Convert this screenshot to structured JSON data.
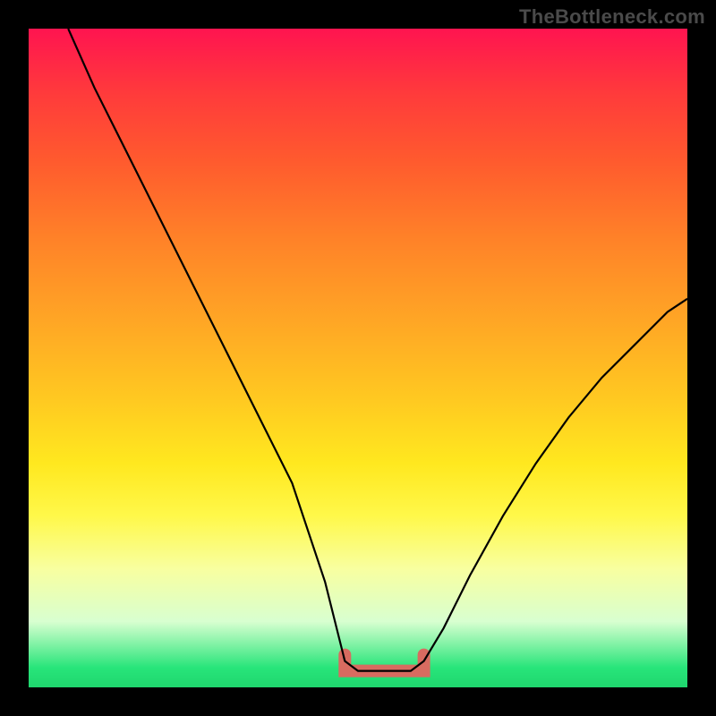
{
  "watermark": "TheBottleneck.com",
  "colors": {
    "curve": "#000000",
    "flat_mark": "#d86b60",
    "gradient_top": "#ff1450",
    "gradient_bottom": "#1fd66e",
    "frame": "#000000"
  },
  "chart_data": {
    "type": "line",
    "title": "",
    "xlabel": "",
    "ylabel": "",
    "xlim": [
      0,
      100
    ],
    "ylim": [
      0,
      100
    ],
    "flat_region": {
      "x_start": 48,
      "x_end": 60,
      "y": 2.5
    },
    "series": [
      {
        "name": "bottleneck-curve",
        "x": [
          6,
          10,
          15,
          20,
          25,
          30,
          35,
          40,
          45,
          48,
          50,
          54,
          58,
          60,
          63,
          67,
          72,
          77,
          82,
          87,
          92,
          97,
          100
        ],
        "y": [
          100,
          91,
          81,
          71,
          61,
          51,
          41,
          31,
          16,
          4,
          2.5,
          2.5,
          2.5,
          4,
          9,
          17,
          26,
          34,
          41,
          47,
          52,
          57,
          59
        ]
      }
    ]
  }
}
